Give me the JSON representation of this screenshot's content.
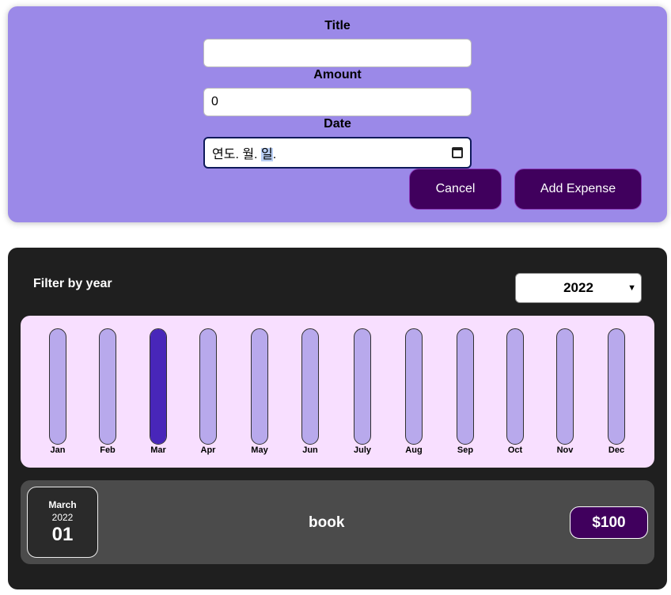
{
  "form": {
    "title_label": "Title",
    "title_value": "",
    "amount_label": "Amount",
    "amount_value": "0",
    "date_label": "Date",
    "date_placeholder_part1": "연도. 월. ",
    "date_placeholder_highlight": "일",
    "date_placeholder_part2": ".",
    "calendar_icon": "calendar-icon",
    "cancel_label": "Cancel",
    "submit_label": "Add Expense",
    "accent_color": "#40005d",
    "background_color": "#9b89e8"
  },
  "filter": {
    "label": "Filter by year",
    "selected_year": "2022"
  },
  "chart_data": {
    "type": "bar",
    "categories": [
      "Jan",
      "Feb",
      "Mar",
      "Apr",
      "May",
      "Jun",
      "July",
      "Aug",
      "Sep",
      "Oct",
      "Nov",
      "Dec"
    ],
    "values": [
      0,
      0,
      100,
      0,
      0,
      0,
      0,
      0,
      0,
      0,
      0,
      0
    ],
    "fill_color": "#4826b9",
    "empty_color": "#b8a9ec"
  },
  "expenses": [
    {
      "month": "March",
      "year": "2022",
      "day": "01",
      "title": "book",
      "amount": "$100"
    }
  ]
}
